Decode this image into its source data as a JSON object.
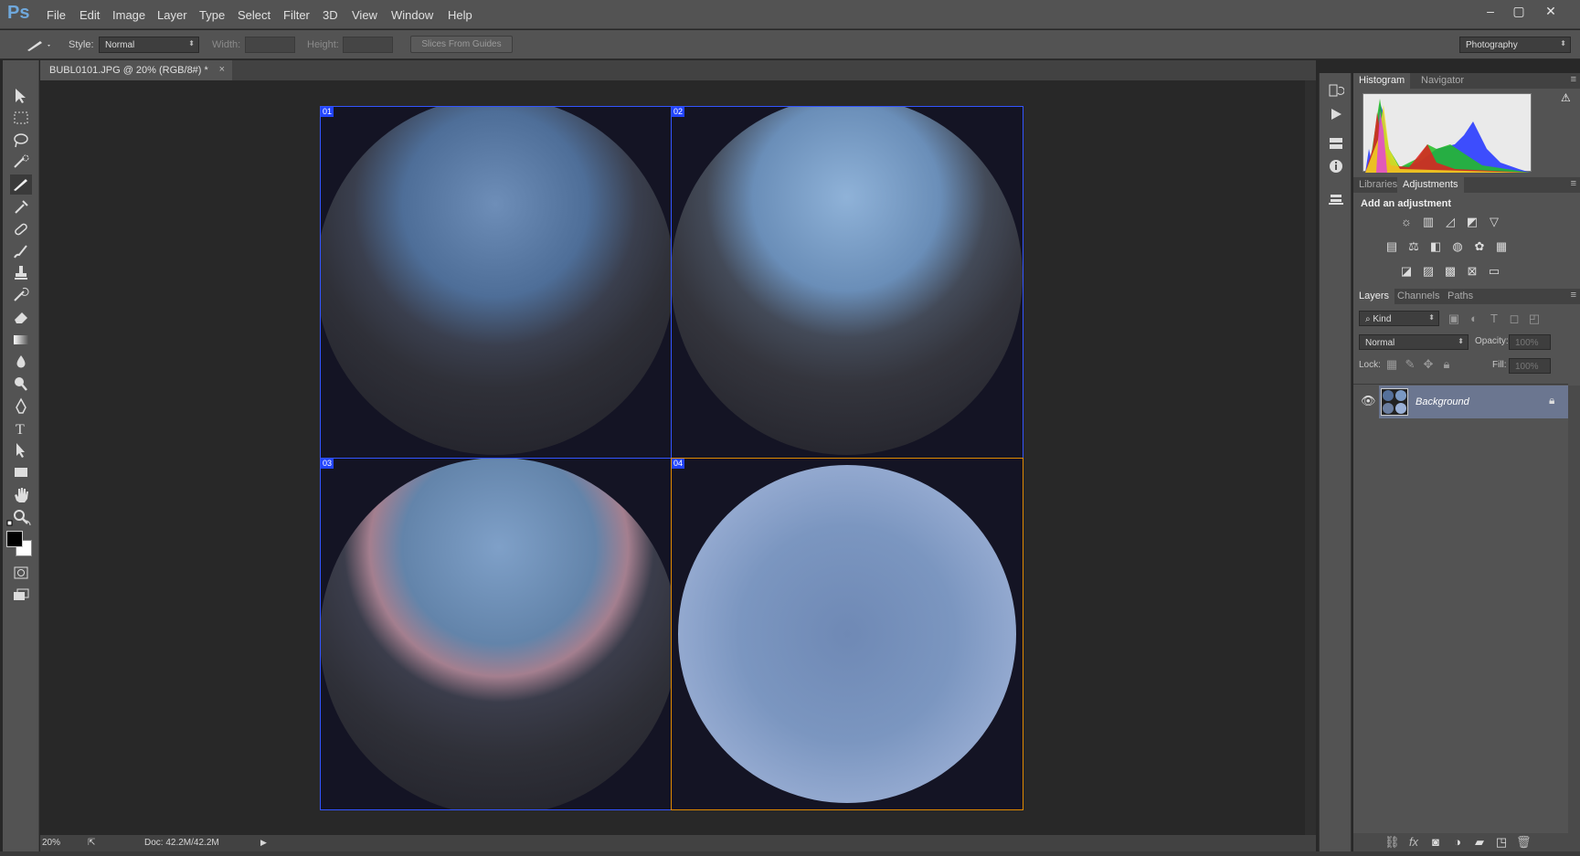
{
  "app": {
    "logo": "Ps"
  },
  "menu": [
    "File",
    "Edit",
    "Image",
    "Layer",
    "Type",
    "Select",
    "Filter",
    "3D",
    "View",
    "Window",
    "Help"
  ],
  "window_controls": {
    "minimize": "–",
    "maximize": "▢",
    "close": "✕"
  },
  "options": {
    "style_label": "Style:",
    "style_value": "Normal",
    "width_label": "Width:",
    "height_label": "Height:",
    "slices_button": "Slices From Guides",
    "workspace": "Photography"
  },
  "document": {
    "tab_title": "BUBL0101.JPG @ 20% (RGB/8#) *",
    "close": "×",
    "slices": [
      "01",
      "02",
      "03",
      "04"
    ]
  },
  "status": {
    "zoom": "20%",
    "doc": "Doc: 42.2M/42.2M"
  },
  "panels": {
    "histogram_tabs": [
      "Histogram",
      "Navigator"
    ],
    "adjust_tabs": [
      "Libraries",
      "Adjustments"
    ],
    "adjust_title": "Add an adjustment",
    "layers_tabs": [
      "Layers",
      "Channels",
      "Paths"
    ],
    "kind": "Kind",
    "blend": "Normal",
    "opacity_label": "Opacity:",
    "opacity_value": "100%",
    "lock_label": "Lock:",
    "fill_label": "Fill:",
    "fill_value": "100%",
    "layer_name": "Background"
  },
  "colors": {
    "accent": "#2244ff",
    "selection": "#ff9900"
  }
}
